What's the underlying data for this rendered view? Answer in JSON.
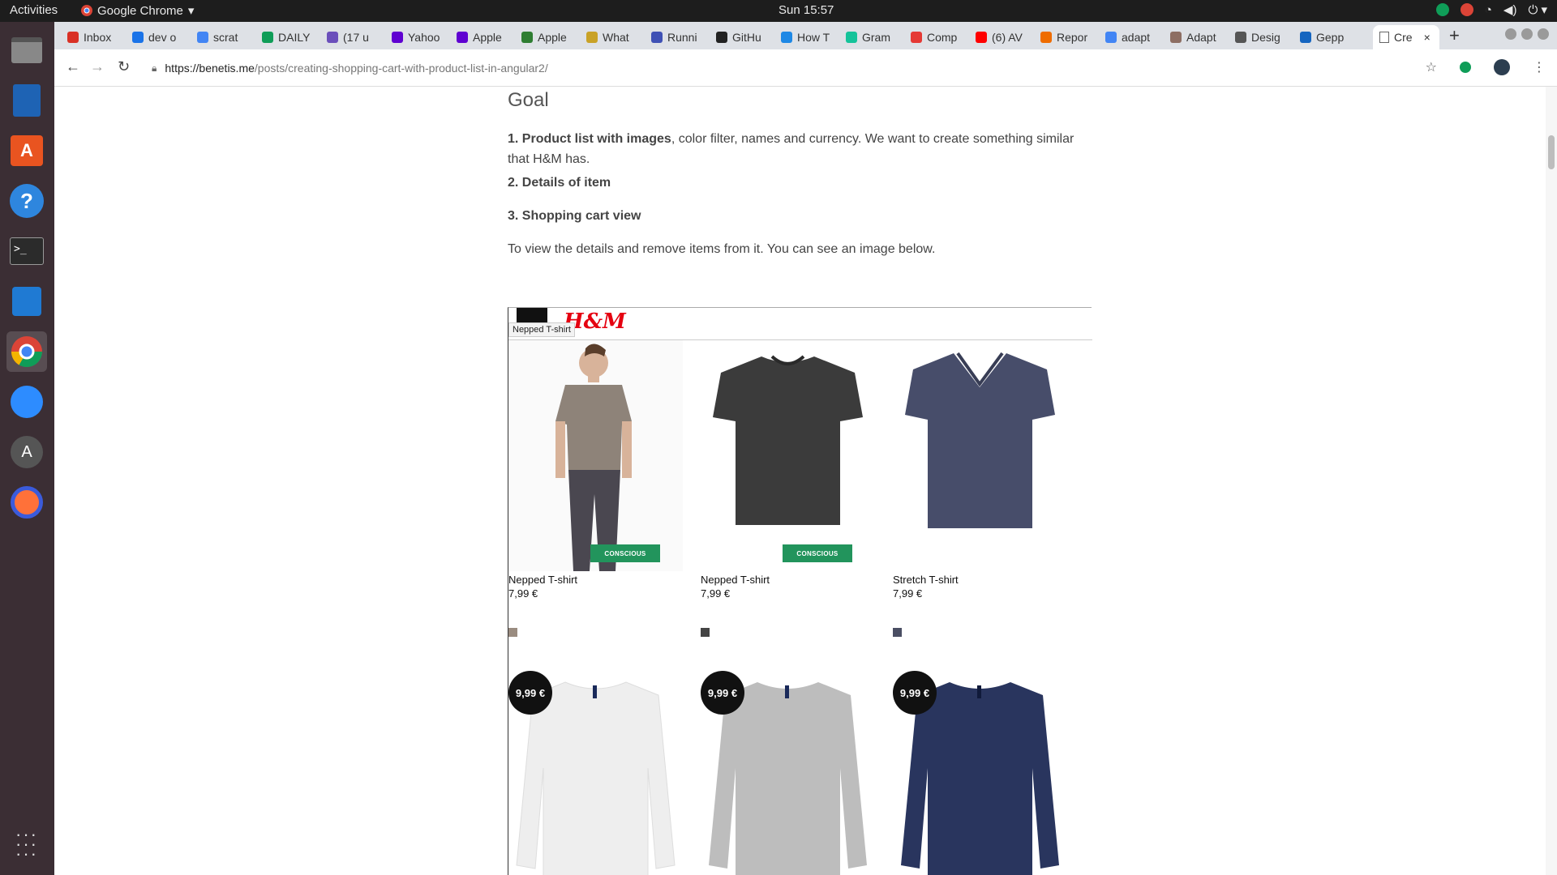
{
  "system": {
    "activities": "Activities",
    "app_name": "Google Chrome",
    "clock": "Sun 15:57"
  },
  "tabs": [
    {
      "label": "Inbox",
      "color": "#d93025"
    },
    {
      "label": "dev o",
      "color": "#1a73e8"
    },
    {
      "label": "scrat",
      "color": "#4285f4"
    },
    {
      "label": "DAILY",
      "color": "#0f9d58"
    },
    {
      "label": "(17 u",
      "color": "#6b4fbb"
    },
    {
      "label": "Yahoo",
      "color": "#5f01d1"
    },
    {
      "label": "Apple",
      "color": "#5f01d1"
    },
    {
      "label": "Apple",
      "color": "#2e7d32"
    },
    {
      "label": "What",
      "color": "#c9a227"
    },
    {
      "label": "Runni",
      "color": "#3f51b5"
    },
    {
      "label": "GitHu",
      "color": "#222222"
    },
    {
      "label": "How T",
      "color": "#1e88e5"
    },
    {
      "label": "Gram",
      "color": "#15c39a"
    },
    {
      "label": "Comp",
      "color": "#e53935"
    },
    {
      "label": "(6) AV",
      "color": "#ff0000"
    },
    {
      "label": "Repor",
      "color": "#ef6c00"
    },
    {
      "label": "adapt",
      "color": "#4285f4"
    },
    {
      "label": "Adapt",
      "color": "#8d6e63"
    },
    {
      "label": "Desig",
      "color": "#555555"
    },
    {
      "label": "Gepp",
      "color": "#1565c0"
    }
  ],
  "active_tab": {
    "label": "Cre",
    "close": "×"
  },
  "new_tab": "+",
  "url": {
    "host": "https://benetis.me",
    "path": "/posts/creating-shopping-cart-with-product-list-in-angular2/"
  },
  "article": {
    "heading": "Goal",
    "item1_bold": "1. Product list with images",
    "item1_rest": ", color filter, names and currency. We want to create something similar that H&M has.",
    "item2": "2. Details of item",
    "item3": "3. Shopping cart view",
    "closing": "To view the details and remove items from it. You can see an image below."
  },
  "shot": {
    "logo": "H&M",
    "tooltip": "Nepped T-shirt",
    "products": [
      {
        "name": "Nepped T-shirt",
        "price": "7,99 €",
        "badge": "CONSCIOUS",
        "swatch": "#9a8c80",
        "shirt": "#8e8379",
        "kind": "model"
      },
      {
        "name": "Nepped T-shirt",
        "price": "7,99 €",
        "badge": "CONSCIOUS",
        "swatch": "#444444",
        "shirt": "#3b3b3b",
        "kind": "tee"
      },
      {
        "name": "Stretch T-shirt",
        "price": "7,99 €",
        "badge": "",
        "swatch": "#4a4e63",
        "shirt": "#474d6a",
        "kind": "vtee"
      }
    ],
    "sweaters": [
      {
        "price": "9,99 €",
        "color": "#eeeeee"
      },
      {
        "price": "9,99 €",
        "color": "#bdbdbd"
      },
      {
        "price": "9,99 €",
        "color": "#29355e"
      }
    ]
  }
}
